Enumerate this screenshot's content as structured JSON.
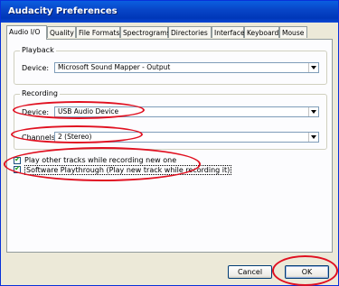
{
  "window": {
    "title": "Audacity Preferences"
  },
  "tabs": [
    {
      "label": "Audio I/O"
    },
    {
      "label": "Quality"
    },
    {
      "label": "File Formats"
    },
    {
      "label": "Spectrograms"
    },
    {
      "label": "Directories"
    },
    {
      "label": "Interface"
    },
    {
      "label": "Keyboard"
    },
    {
      "label": "Mouse"
    }
  ],
  "playback": {
    "group_label": "Playback",
    "device_label": "Device:",
    "device_value": "Microsoft Sound Mapper - Output"
  },
  "recording": {
    "group_label": "Recording",
    "device_label": "Device:",
    "device_value": "USB Audio Device",
    "channels_label": "Channels:",
    "channels_value": "2 (Stereo)"
  },
  "options": {
    "play_other_tracks": {
      "label": "Play other tracks while recording new one",
      "checked": true
    },
    "software_playthrough": {
      "label": "Software Playthrough (Play new track while recording it)",
      "checked": true
    }
  },
  "buttons": {
    "cancel": "Cancel",
    "ok": "OK"
  },
  "annotation_color": "#e01020"
}
